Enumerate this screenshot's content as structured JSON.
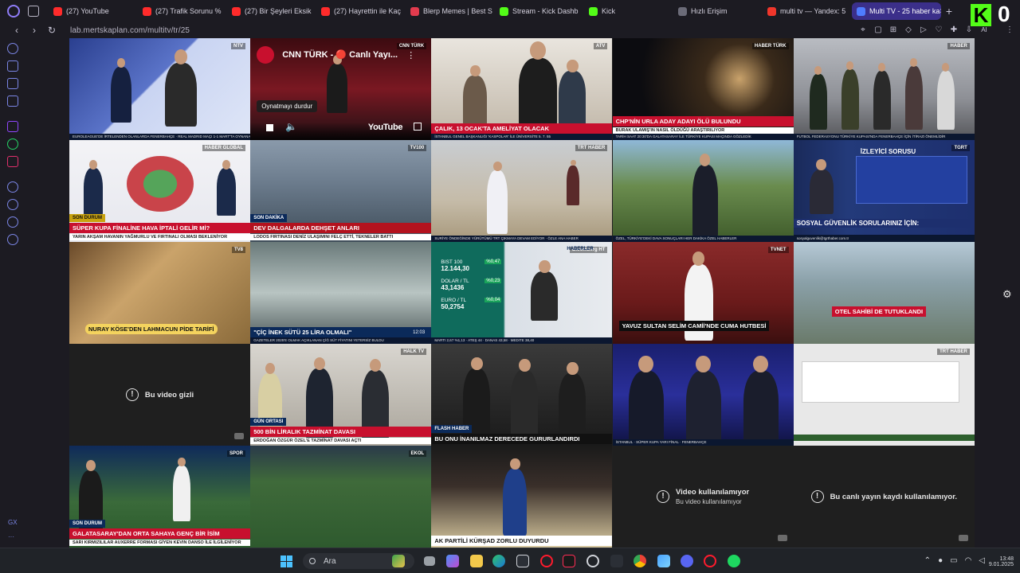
{
  "browser": {
    "tabs": [
      {
        "label": "(27) YouTube",
        "favicon": "youtube",
        "color": "#ff2b2b"
      },
      {
        "label": "(27) Trafik Sorunu %",
        "favicon": "youtube",
        "color": "#ff2b2b"
      },
      {
        "label": "(27) Bir Şeyleri Eksik",
        "favicon": "youtube",
        "color": "#ff2b2b"
      },
      {
        "label": "(27) Hayrettin ile Kaç",
        "favicon": "youtube",
        "color": "#ff2b2b"
      },
      {
        "label": "Blerp Memes | Best S",
        "favicon": "blerp",
        "color": "#e23b4e"
      },
      {
        "label": "Stream - Kick Dashb",
        "favicon": "kick",
        "color": "#53fc18"
      },
      {
        "label": "Kick",
        "favicon": "kick",
        "color": "#53fc18"
      },
      {
        "label": "Hızlı Erişim",
        "favicon": "grid",
        "color": "#6b6b78"
      },
      {
        "label": "multi tv — Yandex: 5",
        "favicon": "yandex",
        "color": "#f0362b"
      },
      {
        "label": "Multi TV - 25 haber ka",
        "favicon": "multitv",
        "color": "#4f7cff",
        "active": true
      }
    ],
    "new_tab": "+",
    "url": "lab.mertskaplan.com/multitv/tr/25"
  },
  "kick": {
    "logo_letter": "K",
    "viewer_count": "0"
  },
  "sidebar": {
    "bottom_label": "GX",
    "more": "···"
  },
  "tiles": [
    {
      "channel": "NTV",
      "scene": "studio-blue",
      "banner": "",
      "ticker": "EUROLEAGUE'DE İRTELENDEN OLANLARDA FENERBAHÇE · REAL MADRID MAÇI 1-1 MART'TA OYNANACAK"
    },
    {
      "channel": "CNN TÜRK",
      "scene": "studio-cnn",
      "youtube_title": "CNN TÜRK - 🔴 Canlı Yayı...",
      "tooltip": "Oynatmayı durdur",
      "youtube_brand": "YouTube"
    },
    {
      "channel": "ATV",
      "scene": "crowd",
      "banner": "ÇALIK, 13 OCAK'TA AMELİYAT OLACAK",
      "banner_color": "#c8102e",
      "ticker": "İSTANBUL GENEL BAŞKANLIĞI 'KASPOLAR' İLE ÜNİVERSİTE 5. 7. 55"
    },
    {
      "channel": "HABER TÜRK",
      "scene": "night",
      "banner": "CHP'NİN URLA ADAY ADAYI ÖLÜ BULUNDU",
      "banner_color": "#c8102e",
      "banner2": "BURAK ULAMIŞ'IN NASIL ÖLDÜĞÜ ARAŞTIRILIYOR",
      "ticker": "TARİH SAAT 20:30'DA GALATASARAY İLE TÜRKİYE KUPASI MAÇINDA GÖZLEDİK"
    },
    {
      "channel": "HABER",
      "scene": "protest",
      "banner": "",
      "ticker": "FUTBOL FEDERASYONU TÜRKİYE KUPASI'NDA FENERBAHÇE İÇİN İTİRAZI ÖNEMLİDİR"
    },
    {
      "channel": "HABER GLOBAL",
      "scene": "stadium-graphic",
      "banner": "SÜPER KUPA FİNALİNE HAVA İPTALİ GELİR Mİ?",
      "banner_color": "#c8102e",
      "banner2": "YARIN AKŞAM HAVANIN YAĞMURLU VE FIRTINALI OLMASI BEKLENİYOR",
      "label_top": "SON DURUM"
    },
    {
      "channel": "TV100",
      "scene": "harbor",
      "banner": "DEV DALGALARDA DEHŞET ANLARI",
      "banner_color": "#b3121e",
      "banner2": "LODOS FIRTINASI DENİZ ULAŞIMINI FELÇ ETTİ, TEKNELER BATTI",
      "label": "SON DAKİKA"
    },
    {
      "channel": "TRT HABER",
      "scene": "beach",
      "banner": "",
      "ticker": "SURİYE ÖNDEĞİNDE YÜRÜTÜMÜ TRT ÇIKMAYA DEVAM EDİYOR · ÖZLE ANA HABER"
    },
    {
      "channel": "",
      "scene": "park",
      "banner": "",
      "ticker": "ÖZEL, TÜRKİYE'DEKİ DAVA SONUÇLARI HER DAKİKA ÖZEL HABERLER"
    },
    {
      "channel": "TGRT",
      "scene": "viewer-question",
      "banner": "İZLEYİCİ SORUSU",
      "banner2": "SOSYAL GÜVENLİK SORULARINIZ İÇİN:",
      "ticker": "sosyalguvenlik@tgrthaber.com.tr",
      "markets": "KIYDE 2.446,55 · NOROZ 86,65 · BIST 50.2740 · MCT 74.40"
    },
    {
      "channel": "TV8",
      "scene": "kitchen",
      "banner": "NURAY KÖSE'DEN LAHMACUN PİDE TARİFİ",
      "banner_color": "#f4d35e"
    },
    {
      "channel": "",
      "scene": "milk",
      "banner": "\"ÇİÇ İNEK SÜTÜ 25 LİRA OLMALI\"",
      "banner_color": "#0b2a5a",
      "ticker": "GAZETELER 2025'E OLMAK AÇIKLANAN ÇİĞ SÜT FİYATINI YETERSİZ BULDU",
      "time": "12:03"
    },
    {
      "channel": "Bloomberg HT",
      "scene": "markets",
      "markets": [
        {
          "name": "BIST 100",
          "value": "12.144,30",
          "change": "%0,47"
        },
        {
          "name": "DOLAR / TL",
          "value": "43,1436",
          "change": "%0,23"
        },
        {
          "name": "EURO / TL",
          "value": "50,2754",
          "change": "%0,04"
        }
      ],
      "label": "HABERLER",
      "ticker": "MARTI 2,67 %1,13 · ATEŞ 44 · DANAS 43,58 · MEDITE 38,40"
    },
    {
      "channel": "TVNET",
      "scene": "mosque",
      "banner": "YAVUZ SULTAN SELİM CAMİİ'NDE CUMA HUTBESİ",
      "banner_color": "#0e0e0e"
    },
    {
      "channel": "",
      "scene": "aerial",
      "banner": "OTEL SAHİBİ DE TUTUKLANDI",
      "banner_color": "#c8102e"
    },
    {
      "error": "Bu video gizli"
    },
    {
      "channel": "HALK TV",
      "scene": "meeting",
      "banner": "500 BİN LİRALIK TAZMİNAT DAVASI",
      "banner_color": "#c8102e",
      "banner2": "ERDOĞAN ÖZGÜR ÖZEL'E TAZMİNAT DAVASI AÇTI",
      "label": "GÜN ORTASI"
    },
    {
      "channel": "",
      "scene": "press",
      "banner": "BU ONU İNANILMAZ DERECEDE GURURLANDIRDI",
      "banner_color": "#111111",
      "label": "FLASH HABER"
    },
    {
      "channel": "",
      "scene": "panel",
      "ticker": "İSTANBUL · SÜPER KUPA YARI FİNAL · FENERBAHÇE"
    },
    {
      "channel": "TRT HABER",
      "scene": "text-card",
      "banner": "",
      "ticker": ""
    },
    {
      "channel": "SPOR",
      "scene": "football",
      "banner": "GALATASARAY'DAN ORTA SAHAYA GENÇ BİR İSİM",
      "banner_color": "#c8102e",
      "banner2": "SARI KIRMIZILILAR AUXERRE FORMASI GİYEN KEVIN DANSO İLE İLGİLENİYOR",
      "label": "SON DURUM"
    },
    {
      "channel": "EKOL",
      "scene": "football-wide",
      "banner": "",
      "ticker": ""
    },
    {
      "channel": "",
      "scene": "stage",
      "banner": "AK PARTİLİ KÜRŞAD ZORLU DUYURDU",
      "banner_color": "#ffffff"
    },
    {
      "error": "Video kullanılamıyor",
      "error_sub": "Bu video kullanılamıyor"
    },
    {
      "error": "Bu canlı yayın kaydı kullanılamıyor."
    }
  ],
  "taskbar": {
    "search_placeholder": "Ara",
    "clock_time": "13:48",
    "clock_date": "9.01.2025"
  }
}
